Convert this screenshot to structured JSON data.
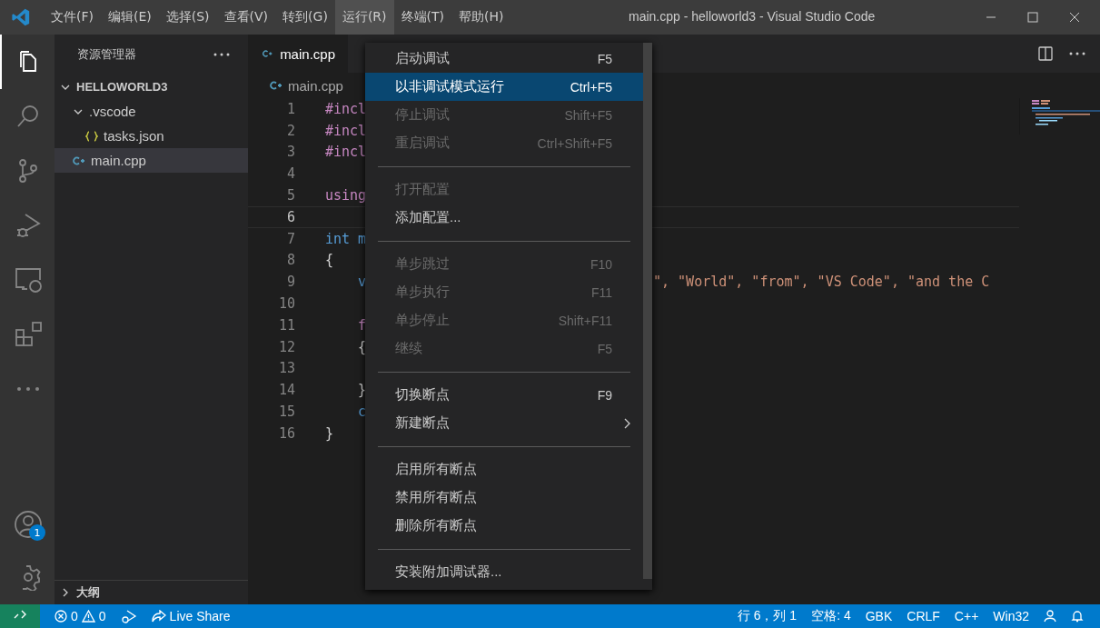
{
  "window": {
    "title": "main.cpp - helloworld3 - Visual Studio Code"
  },
  "menubar": [
    {
      "label": "文件(F)",
      "selected": false
    },
    {
      "label": "编辑(E)",
      "selected": false
    },
    {
      "label": "选择(S)",
      "selected": false
    },
    {
      "label": "查看(V)",
      "selected": false
    },
    {
      "label": "转到(G)",
      "selected": false
    },
    {
      "label": "运行(R)",
      "selected": true
    },
    {
      "label": "终端(T)",
      "selected": false
    },
    {
      "label": "帮助(H)",
      "selected": false
    }
  ],
  "activity_bar": {
    "items": [
      {
        "kind": "explorer",
        "selected": true
      },
      {
        "kind": "search",
        "selected": false
      },
      {
        "kind": "source-control",
        "selected": false
      },
      {
        "kind": "run-debug",
        "selected": false
      },
      {
        "kind": "remote",
        "selected": false
      },
      {
        "kind": "extensions",
        "selected": false
      },
      {
        "kind": "more",
        "selected": false
      }
    ],
    "account_badge": "1"
  },
  "sidebar": {
    "title": "资源管理器",
    "tree": [
      {
        "label": "HELLOWORLD3",
        "kind": "root",
        "expanded": true,
        "selected": false,
        "children": [
          {
            "label": ".vscode",
            "kind": "folder",
            "expanded": true,
            "selected": false,
            "children": [
              {
                "label": "tasks.json",
                "kind": "json",
                "selected": false
              }
            ]
          },
          {
            "label": "main.cpp",
            "kind": "cpp",
            "selected": true
          }
        ]
      }
    ],
    "outline": {
      "label": "大纲",
      "expanded": false
    }
  },
  "tabs": [
    {
      "label": "main.cpp",
      "selected": true
    }
  ],
  "breadcrumb": [
    "main.cpp"
  ],
  "editor": {
    "lines": [
      {
        "n": "1",
        "left": "#incl",
        "kind": "directive",
        "current": false
      },
      {
        "n": "2",
        "left": "#incl",
        "kind": "directive",
        "current": false
      },
      {
        "n": "3",
        "left": "#incl",
        "kind": "directive",
        "current": false
      },
      {
        "n": "4",
        "current": false
      },
      {
        "n": "5",
        "left": "using",
        "kind": "keyword",
        "current": false
      },
      {
        "n": "6",
        "current": true
      },
      {
        "n": "7",
        "left": "int m",
        "kind": "type",
        "current": false
      },
      {
        "n": "8",
        "left": "{",
        "kind": "brace",
        "current": false
      },
      {
        "n": "9",
        "left": "    v",
        "kind": "type",
        "right": "\", \"World\", \"from\", \"VS Code\", \"and the C",
        "current": false
      },
      {
        "n": "10",
        "current": false
      },
      {
        "n": "11",
        "left": "    f",
        "kind": "keyword",
        "current": false
      },
      {
        "n": "12",
        "left": "    {",
        "kind": "brace",
        "current": false
      },
      {
        "n": "13",
        "current": false
      },
      {
        "n": "14",
        "left": "    }",
        "kind": "brace",
        "current": false
      },
      {
        "n": "15",
        "left": "    c",
        "kind": "type",
        "current": false
      },
      {
        "n": "16",
        "left": "}",
        "kind": "brace",
        "current": false
      }
    ]
  },
  "run_menu": [
    {
      "kind": "item",
      "label": "启动调试",
      "shortcut": "F5",
      "disabled": false,
      "selected": false
    },
    {
      "kind": "item",
      "label": "以非调试模式运行",
      "shortcut": "Ctrl+F5",
      "disabled": false,
      "selected": true
    },
    {
      "kind": "item",
      "label": "停止调试",
      "shortcut": "Shift+F5",
      "disabled": true,
      "selected": false
    },
    {
      "kind": "item",
      "label": "重启调试",
      "shortcut": "Ctrl+Shift+F5",
      "disabled": true,
      "selected": false
    },
    {
      "kind": "separator"
    },
    {
      "kind": "item",
      "label": "打开配置",
      "disabled": true,
      "selected": false
    },
    {
      "kind": "item",
      "label": "添加配置...",
      "disabled": false,
      "selected": false
    },
    {
      "kind": "separator"
    },
    {
      "kind": "item",
      "label": "单步跳过",
      "shortcut": "F10",
      "disabled": true,
      "selected": false
    },
    {
      "kind": "item",
      "label": "单步执行",
      "shortcut": "F11",
      "disabled": true,
      "selected": false
    },
    {
      "kind": "item",
      "label": "单步停止",
      "shortcut": "Shift+F11",
      "disabled": true,
      "selected": false
    },
    {
      "kind": "item",
      "label": "继续",
      "shortcut": "F5",
      "disabled": true,
      "selected": false
    },
    {
      "kind": "separator"
    },
    {
      "kind": "item",
      "label": "切换断点",
      "shortcut": "F9",
      "disabled": false,
      "selected": false
    },
    {
      "kind": "submenu",
      "label": "新建断点",
      "disabled": false,
      "selected": false
    },
    {
      "kind": "separator"
    },
    {
      "kind": "item",
      "label": "启用所有断点",
      "disabled": false,
      "selected": false
    },
    {
      "kind": "item",
      "label": "禁用所有断点",
      "disabled": false,
      "selected": false
    },
    {
      "kind": "item",
      "label": "删除所有断点",
      "disabled": false,
      "selected": false
    },
    {
      "kind": "separator"
    },
    {
      "kind": "item",
      "label": "安装附加调试器...",
      "disabled": false,
      "selected": false
    }
  ],
  "status_bar": {
    "errors": "0",
    "warnings": "0",
    "live_share": "Live Share",
    "right": [
      "行 6，列 1",
      "空格: 4",
      "GBK",
      "CRLF",
      "C++",
      "Win32"
    ]
  }
}
